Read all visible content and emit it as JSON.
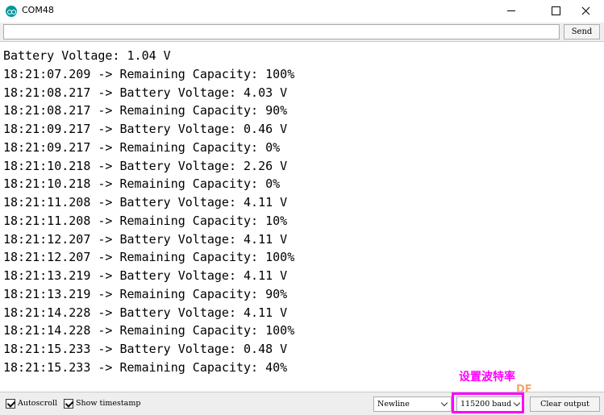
{
  "window": {
    "title": "COM48"
  },
  "send_bar": {
    "input_value": "",
    "send_label": "Send"
  },
  "console_lines": [
    "Battery Voltage: 1.04 V",
    "18:21:07.209 -> Remaining Capacity: 100%",
    "18:21:08.217 -> Battery Voltage: 4.03 V",
    "18:21:08.217 -> Remaining Capacity: 90%",
    "18:21:09.217 -> Battery Voltage: 0.46 V",
    "18:21:09.217 -> Remaining Capacity: 0%",
    "18:21:10.218 -> Battery Voltage: 2.26 V",
    "18:21:10.218 -> Remaining Capacity: 0%",
    "18:21:11.208 -> Battery Voltage: 4.11 V",
    "18:21:11.208 -> Remaining Capacity: 10%",
    "18:21:12.207 -> Battery Voltage: 4.11 V",
    "18:21:12.207 -> Remaining Capacity: 100%",
    "18:21:13.219 -> Battery Voltage: 4.11 V",
    "18:21:13.219 -> Remaining Capacity: 90%",
    "18:21:14.228 -> Battery Voltage: 4.11 V",
    "18:21:14.228 -> Remaining Capacity: 100%",
    "18:21:15.233 -> Battery Voltage: 0.48 V",
    "18:21:15.233 -> Remaining Capacity: 40%"
  ],
  "annotation": {
    "text": "设置波特率",
    "color": "#ff00ff"
  },
  "bottom_bar": {
    "autoscroll_label": "Autoscroll",
    "autoscroll_checked": true,
    "timestamp_label": "Show timestamp",
    "timestamp_checked": true,
    "line_ending": "Newline",
    "baud_rate": "115200 baud",
    "clear_label": "Clear output"
  },
  "watermark": {
    "text": "DF"
  },
  "colors": {
    "accent": "#00979c",
    "highlight": "#ff00ff"
  }
}
